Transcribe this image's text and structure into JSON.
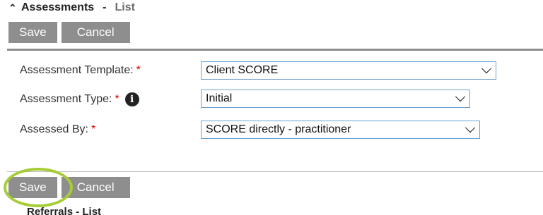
{
  "header": {
    "title": "Assessments",
    "separator": "-",
    "subtitle": "List"
  },
  "toolbar_top": {
    "save_label": "Save",
    "cancel_label": "Cancel"
  },
  "form": {
    "template": {
      "label": "Assessment Template:",
      "required_mark": "*",
      "value": "Client SCORE"
    },
    "type": {
      "label": "Assessment Type:",
      "required_mark": "*",
      "info_glyph": "i",
      "value": "Initial"
    },
    "assessed_by": {
      "label": "Assessed By:",
      "required_mark": "*",
      "value": "SCORE directly - practitioner"
    }
  },
  "toolbar_bottom": {
    "save_label": "Save",
    "cancel_label": "Cancel"
  },
  "next_section_partial": "Referrals - List",
  "colors": {
    "button_bg": "#8e8e8e",
    "required": "#dd0000",
    "select_border": "#6b9fd1",
    "highlight_ring": "#a6cd38"
  }
}
